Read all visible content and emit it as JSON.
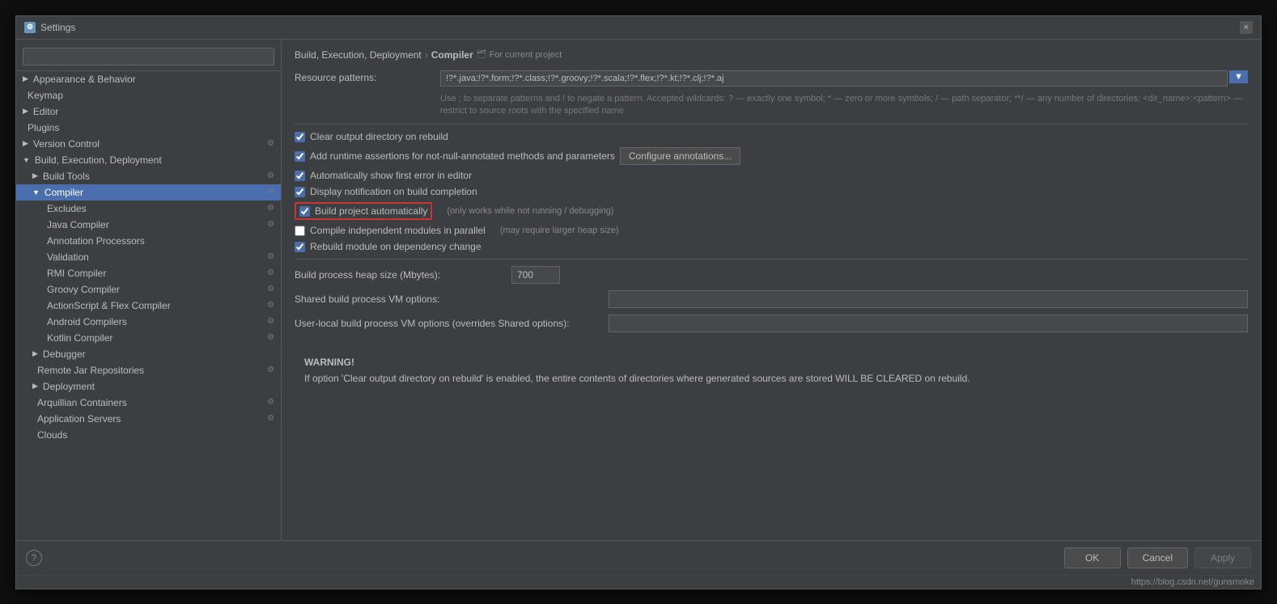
{
  "dialog": {
    "title": "Settings",
    "title_icon": "⚙",
    "close_label": "×"
  },
  "search": {
    "placeholder": ""
  },
  "sidebar": {
    "items": [
      {
        "id": "appearance",
        "label": "Appearance & Behavior",
        "level": "l1",
        "arrow": "▶",
        "selected": false
      },
      {
        "id": "keymap",
        "label": "Keymap",
        "level": "l1",
        "arrow": "",
        "selected": false
      },
      {
        "id": "editor",
        "label": "Editor",
        "level": "l1",
        "arrow": "▶",
        "selected": false
      },
      {
        "id": "plugins",
        "label": "Plugins",
        "level": "l1",
        "arrow": "",
        "selected": false
      },
      {
        "id": "version-control",
        "label": "Version Control",
        "level": "l1",
        "arrow": "▶",
        "selected": false
      },
      {
        "id": "build-execution",
        "label": "Build, Execution, Deployment",
        "level": "l1",
        "arrow": "▼",
        "selected": false
      },
      {
        "id": "build-tools",
        "label": "Build Tools",
        "level": "l2",
        "arrow": "▶",
        "selected": false
      },
      {
        "id": "compiler",
        "label": "Compiler",
        "level": "l2",
        "arrow": "▼",
        "selected": true
      },
      {
        "id": "excludes",
        "label": "Excludes",
        "level": "l3",
        "arrow": "",
        "selected": false
      },
      {
        "id": "java-compiler",
        "label": "Java Compiler",
        "level": "l3",
        "arrow": "",
        "selected": false
      },
      {
        "id": "annotation-processors",
        "label": "Annotation Processors",
        "level": "l3",
        "arrow": "",
        "selected": false
      },
      {
        "id": "validation",
        "label": "Validation",
        "level": "l3",
        "arrow": "",
        "selected": false
      },
      {
        "id": "rmi-compiler",
        "label": "RMI Compiler",
        "level": "l3",
        "arrow": "",
        "selected": false
      },
      {
        "id": "groovy-compiler",
        "label": "Groovy Compiler",
        "level": "l3",
        "arrow": "",
        "selected": false
      },
      {
        "id": "actionscript-flex",
        "label": "ActionScript & Flex Compiler",
        "level": "l3",
        "arrow": "",
        "selected": false
      },
      {
        "id": "android-compilers",
        "label": "Android Compilers",
        "level": "l3",
        "arrow": "",
        "selected": false
      },
      {
        "id": "kotlin-compiler",
        "label": "Kotlin Compiler",
        "level": "l3",
        "arrow": "",
        "selected": false
      },
      {
        "id": "debugger",
        "label": "Debugger",
        "level": "l2",
        "arrow": "▶",
        "selected": false
      },
      {
        "id": "remote-jar-repos",
        "label": "Remote Jar Repositories",
        "level": "l2",
        "arrow": "",
        "selected": false
      },
      {
        "id": "deployment",
        "label": "Deployment",
        "level": "l2",
        "arrow": "▶",
        "selected": false
      },
      {
        "id": "arquillian-containers",
        "label": "Arquillian Containers",
        "level": "l2",
        "arrow": "",
        "selected": false
      },
      {
        "id": "application-servers",
        "label": "Application Servers",
        "level": "l2",
        "arrow": "",
        "selected": false
      },
      {
        "id": "clouds",
        "label": "Clouds",
        "level": "l2",
        "arrow": "",
        "selected": false
      }
    ]
  },
  "content": {
    "breadcrumb_path": "Build, Execution, Deployment",
    "breadcrumb_sep": "›",
    "breadcrumb_current": "Compiler",
    "project_tag": "For current project",
    "resource_label": "Resource patterns:",
    "resource_value": "!?*.java;!?*.form;!?*.class;!?*.groovy;!?*.scala;!?*.flex;!?*.kt;!?*.clj;!?*.aj",
    "resource_hint": "Use ; to separate patterns and ! to negate a pattern. Accepted wildcards: ? — exactly one symbol; * — zero or more symbols; / — path separator; **/ — any number of directories; <dir_name>:<pattern> — restrict to source roots with the specified name",
    "checkbox_clear_output": "Clear output directory on rebuild",
    "checkbox_clear_output_checked": true,
    "checkbox_runtime": "Add runtime assertions for not-null-annotated methods and parameters",
    "checkbox_runtime_checked": true,
    "configure_btn_label": "Configure annotations...",
    "checkbox_show_error": "Automatically show first error in editor",
    "checkbox_show_error_checked": true,
    "checkbox_display_notification": "Display notification on build completion",
    "checkbox_display_notification_checked": true,
    "checkbox_build_auto": "Build project automatically",
    "checkbox_build_auto_checked": true,
    "build_auto_note": "(only works while not running / debugging)",
    "checkbox_compile_parallel": "Compile independent modules in parallel",
    "checkbox_compile_parallel_checked": false,
    "compile_parallel_note": "(may require larger heap size)",
    "checkbox_rebuild_module": "Rebuild module on dependency change",
    "checkbox_rebuild_module_checked": true,
    "heap_label": "Build process heap size (Mbytes):",
    "heap_value": "700",
    "shared_vm_label": "Shared build process VM options:",
    "shared_vm_value": "",
    "user_vm_label": "User-local build process VM options (overrides Shared options):",
    "user_vm_value": "",
    "warning_title": "WARNING!",
    "warning_text": "If option 'Clear output directory on rebuild' is enabled, the entire contents of directories where generated sources are stored WILL BE CLEARED on rebuild."
  },
  "footer": {
    "ok_label": "OK",
    "cancel_label": "Cancel",
    "apply_label": "Apply",
    "help_label": "?"
  },
  "statusbar": {
    "url": "https://blog.csdn.net/gunsmoke"
  }
}
